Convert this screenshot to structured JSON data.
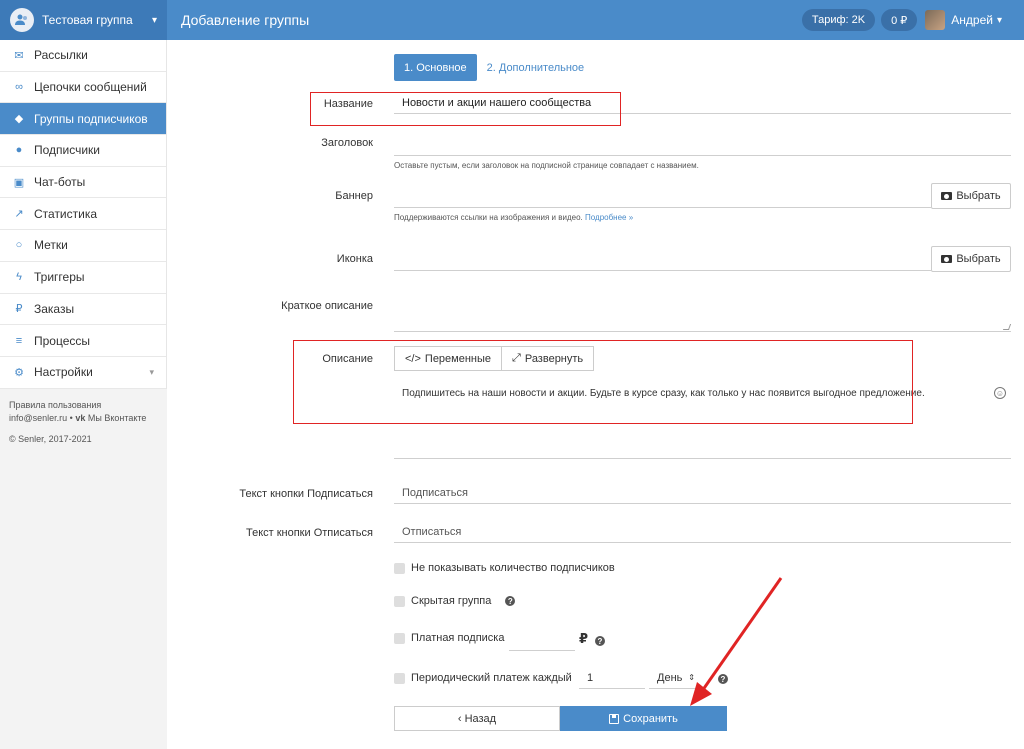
{
  "header": {
    "group_name": "Тестовая группа",
    "page_title": "Добавление группы",
    "tariff": "Тариф: 2K",
    "balance": "0 ₽",
    "user_name": "Андрей"
  },
  "sidebar": {
    "items": [
      {
        "label": "Рассылки",
        "icon": "envelope-icon"
      },
      {
        "label": "Цепочки сообщений",
        "icon": "chain-icon"
      },
      {
        "label": "Группы подписчиков",
        "icon": "tags-icon",
        "active": true
      },
      {
        "label": "Подписчики",
        "icon": "users-icon"
      },
      {
        "label": "Чат-боты",
        "icon": "android-icon"
      },
      {
        "label": "Статистика",
        "icon": "chart-icon"
      },
      {
        "label": "Метки",
        "icon": "circle-icon"
      },
      {
        "label": "Триггеры",
        "icon": "bolt-icon"
      },
      {
        "label": "Заказы",
        "icon": "ruble-icon"
      },
      {
        "label": "Процессы",
        "icon": "stack-icon"
      },
      {
        "label": "Настройки",
        "icon": "cogs-icon"
      }
    ],
    "footer": {
      "terms": "Правила пользования",
      "email": "info@senler.ru",
      "vk": "Мы Вконтакте",
      "copyright": "© Senler, 2017-2021"
    }
  },
  "tabs": {
    "main": "1. Основное",
    "extra": "2. Дополнительное"
  },
  "form": {
    "name_label": "Название",
    "name_value": "Новости и акции нашего сообщества",
    "title_label": "Заголовок",
    "title_hint": "Оставьте пустым, если заголовок на подписной странице совпадает с названием.",
    "banner_label": "Баннер",
    "banner_hint": "Поддерживаются ссылки на изображения и видео.",
    "banner_hint_link": "Подробнее »",
    "choose_label": "Выбрать",
    "icon_label": "Иконка",
    "short_desc_label": "Краткое описание",
    "desc_label": "Описание",
    "variables_btn": "Переменные",
    "expand_btn": "Развернуть",
    "desc_text": "Подпишитесь на наши новости и акции. Будьте в курсе сразу, как только у нас появится выгодное предложение.",
    "subscribe_label": "Текст кнопки Подписаться",
    "subscribe_value": "Подписаться",
    "unsubscribe_label": "Текст кнопки Отписаться",
    "unsubscribe_value": "Отписаться",
    "hide_count": "Не показывать количество подписчиков",
    "hidden_group": "Скрытая группа",
    "paid": "Платная подписка",
    "currency": "₽",
    "periodic": "Периодический платеж каждый",
    "period_value": "1",
    "period_unit": "День",
    "back": "Назад",
    "save": "Сохранить"
  },
  "colors": {
    "accent": "#4a8bc9",
    "highlight": "#e02424"
  }
}
